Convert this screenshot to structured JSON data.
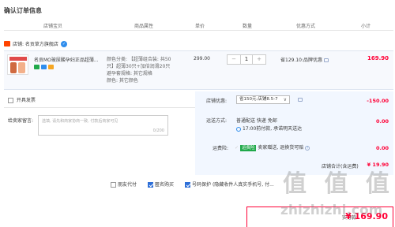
{
  "page_title": "确认订单信息",
  "columns": [
    "店铺宝贝",
    "商品属性",
    "单价",
    "数量",
    "优惠方式",
    "小计"
  ],
  "store": {
    "label": "店铺: 名贡草方旗舰店"
  },
  "item": {
    "title": "名贡MO玻尿酸孕妇正品超薄...",
    "sku_lines": [
      "颜色分类: 【超薄组合装: 共50",
      "只】超薄30只+加倍润滑20只",
      "避孕套规格: 其它规格",
      "颜色: 其它颜色"
    ],
    "price": "299.00",
    "quantity": "1",
    "qty_minus": "−",
    "qty_plus": "+",
    "promo": "省129.10:品牌优惠",
    "subtotal": "169.90"
  },
  "invoice": {
    "label": "开具发票"
  },
  "message": {
    "label": "给卖家留言:",
    "placeholder": "选填, 请先和商家协商一致, 付款后商家可见",
    "counter": "0/200"
  },
  "store_discount": {
    "label": "店铺优惠:",
    "option": "省150元:店铺8.5-7",
    "value": "-150.00"
  },
  "shipping": {
    "label": "运送方式:",
    "method": "普通配送 快递 免邮",
    "time": "17:00前付款, 承诺明天送达",
    "value": "0.00"
  },
  "insurance": {
    "label": "运费险:",
    "chip": "运费险",
    "desc": "卖家赠送, 退换货可赔",
    "value": "0.00"
  },
  "store_total": {
    "label": "店铺合计(含运费)",
    "value": "¥ 19.90"
  },
  "bottom_options": [
    {
      "label": "朋友代付",
      "checked": false
    },
    {
      "label": "匿名购买",
      "checked": true
    },
    {
      "label": "号码保护 (隐藏收件人真实手机号, 付...",
      "checked": true
    }
  ],
  "final": {
    "label": "实付款:",
    "value": "¥ 169.90"
  },
  "watermark": {
    "glyphs": "值 值 值",
    "url": "zhizhizhi.com"
  },
  "colors": {
    "accent_red": "#ff0036",
    "link_blue": "#2e6fd8",
    "panel_bg": "#f2f7ff"
  }
}
